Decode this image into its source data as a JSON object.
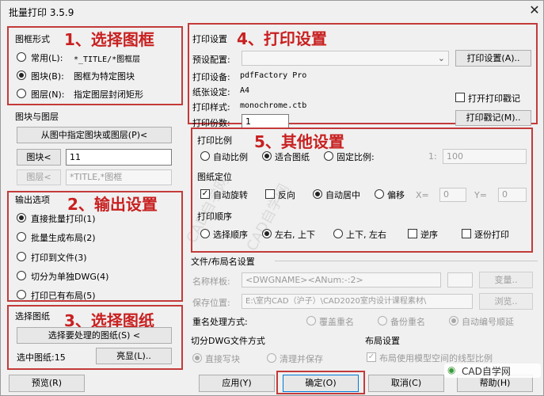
{
  "window": {
    "title": "批量打印 3.5.9",
    "close_glyph": "✕"
  },
  "frame_style": {
    "group_label": "图框形式",
    "annotation": "1、选择图框",
    "options": [
      {
        "label": "常用(L):",
        "value": "*_TITLE/*图框层",
        "selected": false
      },
      {
        "label": "图块(B):",
        "value": "图框为特定图块",
        "selected": true
      },
      {
        "label": "图层(N):",
        "value": "指定图层封闭矩形",
        "selected": false
      }
    ]
  },
  "block_layer": {
    "group_label": "图块与图层",
    "pick_button": "从图中指定图块或图层(P)<",
    "block_button": "图块<",
    "block_value": "11",
    "layer_button": "图层<",
    "layer_value": "*TITLE,*图框"
  },
  "output": {
    "group_label": "输出选项",
    "annotation": "2、输出设置",
    "options": [
      {
        "label": "直接批量打印(1)",
        "selected": true
      },
      {
        "label": "批量生成布局(2)",
        "selected": false
      },
      {
        "label": "打印到文件(3)",
        "selected": false
      },
      {
        "label": "切分为单独DWG(4)",
        "selected": false
      },
      {
        "label": "打印已有布局(5)",
        "selected": false
      }
    ]
  },
  "select_drawing": {
    "group_label": "选择图纸",
    "annotation": "3、选择图纸",
    "select_button": "选择要处理的图纸(S) <",
    "count_label": "选中图纸:15",
    "highlight_button": "亮显(L).."
  },
  "print_settings": {
    "group_label": "打印设置",
    "annotation": "4、打印设置",
    "preset_label": "预设配置:",
    "preset_value": "",
    "print_settings_button": "打印设置(A)..",
    "device_label": "打印设备:",
    "device_value": "pdfFactory Pro",
    "paper_label": "纸张设定:",
    "paper_value": "A4",
    "style_label": "打印样式:",
    "style_value": "monochrome.ctb",
    "stamp_checkbox_label": "打开打印戳记",
    "stamp_checked": false,
    "copies_label": "打印份数:",
    "copies_value": "1",
    "stamp_button": "打印戳记(M).."
  },
  "other": {
    "annotation": "5、其他设置",
    "scale_label": "打印比例",
    "scale_options": [
      {
        "label": "自动比例",
        "selected": false
      },
      {
        "label": "适合图纸",
        "selected": true
      },
      {
        "label": "固定比例:",
        "selected": false
      }
    ],
    "scale_prefix": "1:",
    "scale_value": "100",
    "position_label": "图纸定位",
    "auto_rotate_label": "自动旋转",
    "auto_rotate_checked": true,
    "reverse_label": "反向",
    "reverse_checked": false,
    "center_options": [
      {
        "label": "自动居中",
        "selected": true
      },
      {
        "label": "偏移",
        "selected": false
      }
    ],
    "x_label": "X=",
    "x_value": "0",
    "y_label": "Y=",
    "y_value": "0",
    "order_label": "打印顺序",
    "order_options": [
      {
        "label": "选择顺序",
        "selected": false
      },
      {
        "label": "左右, 上下",
        "selected": true
      },
      {
        "label": "上下, 左右",
        "selected": false
      }
    ],
    "reverse_order_label": "逆序",
    "reverse_order_checked": false,
    "page_by_page_label": "逐份打印",
    "page_by_page_checked": false
  },
  "file_layout": {
    "group_label": "文件/布局名设置",
    "name_label": "名称样板:",
    "name_value": "<DWGNAME><ANum:-:2>",
    "variable_button": "变量..",
    "save_label": "保存位置:",
    "save_value": "E:\\室内CAD（沪子）\\CAD2020室内设计课程素材\\",
    "browse_button": "浏览.."
  },
  "rename": {
    "label": "重名处理方式:",
    "options": [
      {
        "label": "覆盖重名",
        "selected": false
      },
      {
        "label": "备份重名",
        "selected": false
      },
      {
        "label": "自动编号顺延",
        "selected": true
      }
    ]
  },
  "split_dwg": {
    "group_label": "切分DWG文件方式",
    "options": [
      {
        "label": "直接写块",
        "selected": true
      },
      {
        "label": "清理并保存",
        "selected": false
      }
    ]
  },
  "layout": {
    "group_label": "布局设置",
    "linetype_label": "布局使用模型空间的线型比例",
    "linetype_checked": true
  },
  "bottom": {
    "preview_button": "预览(R)",
    "apply_button": "应用(Y)",
    "ok_button": "确定(O)",
    "cancel_button": "取消(C)",
    "help_button": "帮助(H)"
  },
  "watermark_text": "CAD自学网",
  "colors": {
    "annotation": "#c82020",
    "annotation_box": "#c43a3a"
  }
}
